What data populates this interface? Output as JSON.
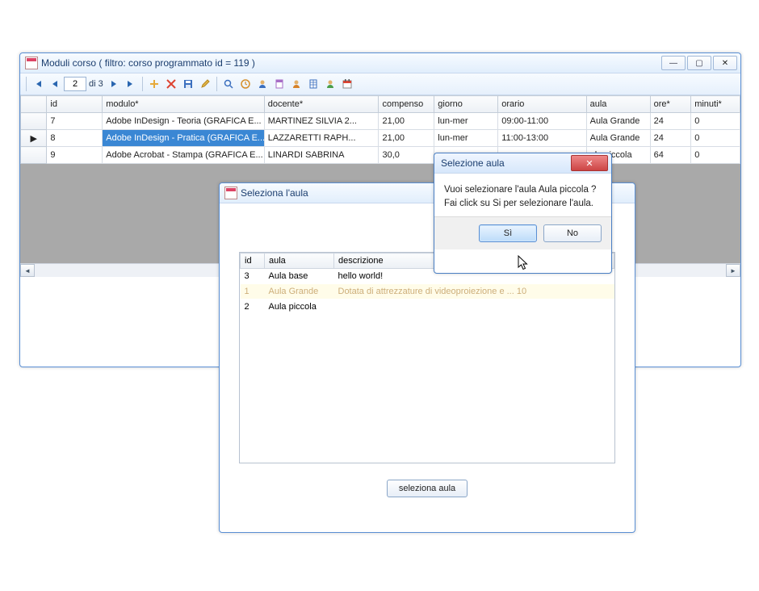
{
  "main": {
    "title": "Moduli corso ( filtro: corso programmato id = 119 )",
    "pager": {
      "pos": "2",
      "of": "di 3"
    },
    "columns": [
      "id",
      "modulo*",
      "docente*",
      "compenso",
      "giorno",
      "orario",
      "aula",
      "ore*",
      "minuti*"
    ],
    "rows": [
      {
        "sel": false,
        "cur": false,
        "id": "7",
        "modulo": "Adobe InDesign - Teoria (GRAFICA E...",
        "docente": "MARTINEZ SILVIA 2...",
        "compenso": "21,00",
        "giorno": "lun-mer",
        "orario": "09:00-11:00",
        "aula": "Aula Grande",
        "ore": "24",
        "minuti": "0"
      },
      {
        "sel": true,
        "cur": true,
        "id": "8",
        "modulo": "Adobe InDesign - Pratica (GRAFICA E...",
        "docente": "LAZZARETTI RAPH...",
        "compenso": "21,00",
        "giorno": "lun-mer",
        "orario": "11:00-13:00",
        "aula": "Aula Grande",
        "ore": "24",
        "minuti": "0"
      },
      {
        "sel": false,
        "cur": false,
        "id": "9",
        "modulo": "Adobe Acrobat - Stampa (GRAFICA E...",
        "docente": "LINARDI SABRINA",
        "compenso": "30,0",
        "giorno": "",
        "orario": "",
        "aula": "ula piccola",
        "ore": "64",
        "minuti": "0"
      }
    ]
  },
  "chooser": {
    "title": "Seleziona l'aula",
    "cols": {
      "id": "id",
      "aula": "aula",
      "desc": "descrizione"
    },
    "rows": [
      {
        "id": "3",
        "aula": "Aula base",
        "desc": "hello world!",
        "alt": false
      },
      {
        "id": "1",
        "aula": "Aula Grande",
        "desc": "Dotata di attrezzature di videoproiezione e ...   10",
        "alt": true
      },
      {
        "id": "2",
        "aula": "Aula piccola",
        "desc": "",
        "alt": false
      }
    ],
    "button": "seleziona aula"
  },
  "confirm": {
    "title": "Selezione aula",
    "line1": "Vuoi selezionare l'aula Aula piccola ?",
    "line2": "Fai click su Si per selezionare l'aula.",
    "yes": "Sì",
    "no": "No"
  }
}
